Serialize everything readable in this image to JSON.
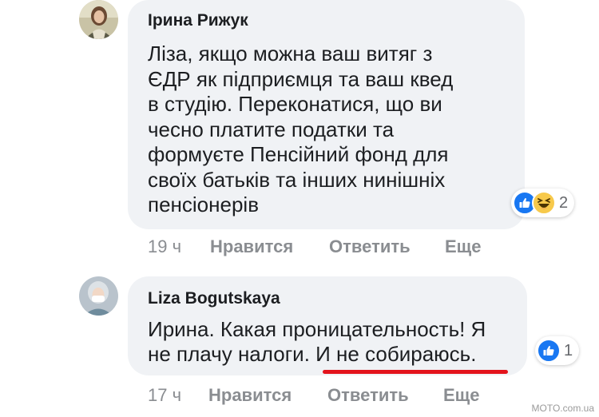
{
  "comments": [
    {
      "author": "Ірина Рижук",
      "text_lines": [
        "Ліза, якщо можна ваш витяг з",
        "ЄДР як підприємця та ваш квед",
        "в студію. Переконатися, що ви",
        "чесно платите податки та",
        "формуєте Пенсійний фонд для",
        "своїх батьків та інших нинішніх",
        "пенсіонерів"
      ],
      "reactions": {
        "icons": [
          "like-icon",
          "haha-icon"
        ],
        "count": "2"
      },
      "time": "19 ч",
      "like_label": "Нравится",
      "reply_label": "Ответить",
      "more_label": "Еще"
    },
    {
      "author": "Liza Bogutskaya",
      "text_lines": [
        "Ирина. Какая проницательность! Я",
        "не плачу налоги. И не собираюсь."
      ],
      "reactions": {
        "icons": [
          "like-icon"
        ],
        "count": "1"
      },
      "time": "17 ч",
      "like_label": "Нравится",
      "reply_label": "Ответить",
      "more_label": "Еще"
    }
  ],
  "watermark": "MOTO.com.ua",
  "colors": {
    "bubble": "#f0f2f5",
    "like_blue": "#1877f2",
    "haha_yellow": "#f7c94b",
    "highlight_underline": "#e3141c",
    "muted_text": "#8a8d91"
  }
}
